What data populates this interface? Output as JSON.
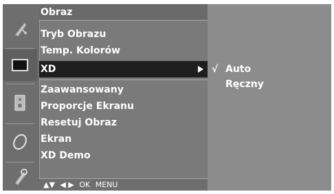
{
  "menu": {
    "title": "Obraz",
    "items": [
      {
        "label": "Tryb Obrazu"
      },
      {
        "label": "Temp. Kolorów"
      },
      {
        "label": "XD"
      },
      {
        "label": "Zaawansowany"
      },
      {
        "label": "Proporcje Ekranu"
      },
      {
        "label": "Resetuj Obraz"
      },
      {
        "label": "Ekran"
      },
      {
        "label": "XD Demo"
      }
    ],
    "selected_index": 2,
    "footer": {
      "nav_updown": "▲▼",
      "nav_leftright": "◀ ▶",
      "ok": "OK",
      "menu": "MENU"
    }
  },
  "submenu": {
    "items": [
      {
        "label": "Auto",
        "checked": true,
        "mark": "√"
      },
      {
        "label": "Ręczny",
        "checked": false,
        "mark": ""
      }
    ]
  },
  "icons": [
    "satellite-dish-icon",
    "tv-screen-icon",
    "speaker-icon",
    "clock-icon",
    "gear-icon"
  ],
  "colors": {
    "panel": "#6e6e6e",
    "menu": "#7a7a7a",
    "submenu": "#8c8c8c",
    "highlight": "#1e1e1e",
    "text": "#ffffff"
  }
}
